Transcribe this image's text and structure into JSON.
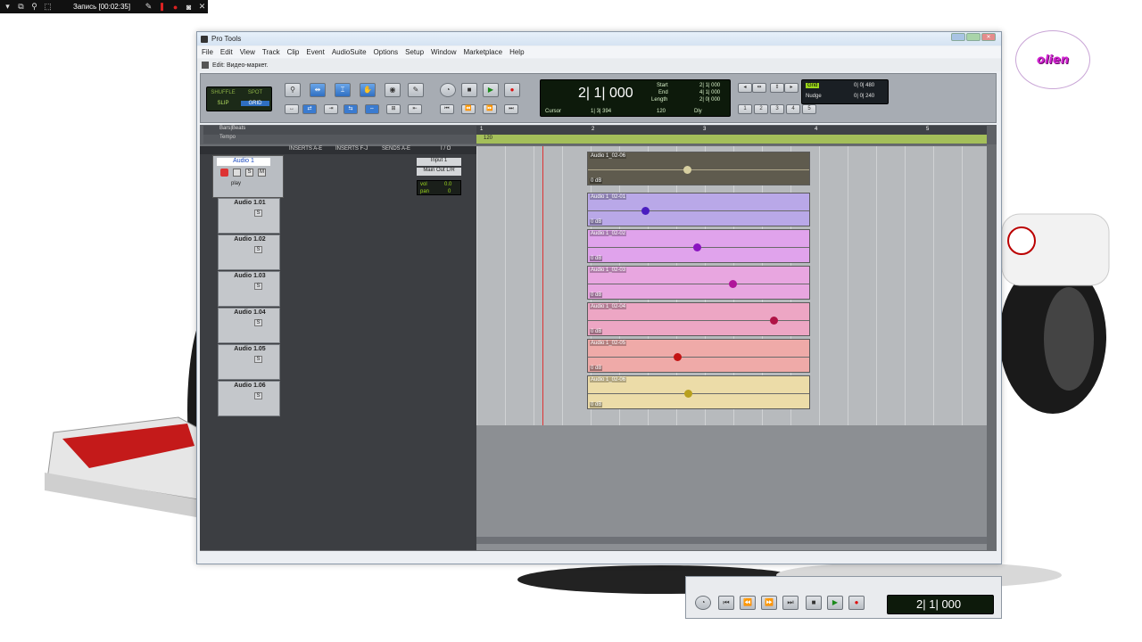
{
  "recorder": {
    "title": "Запись [00:02:35]"
  },
  "logo": {
    "text": "olien"
  },
  "window": {
    "title": "Pro Tools",
    "menu": [
      "File",
      "Edit",
      "View",
      "Track",
      "Clip",
      "Event",
      "AudioSuite",
      "Options",
      "Setup",
      "Window",
      "Marketplace",
      "Help"
    ],
    "edit_title": "Edit: Видео-маркет."
  },
  "toolbar": {
    "modes": [
      "SHUFFLE",
      "SPOT",
      "SLIP",
      "GRID"
    ],
    "counter_main": "2| 1| 000",
    "start_label": "Start",
    "end_label": "End",
    "length_label": "Length",
    "start_val": "2| 1| 000",
    "end_val": "4| 1| 000",
    "length_val": "2| 0| 000",
    "cursor_label": "Cursor",
    "cursor_val": "1| 3| 394",
    "tempo_val": "120",
    "dly_label": "Dly",
    "grid_label": "Grid",
    "grid_val": "0| 0| 480",
    "nudge_label": "Nudge",
    "nudge_val": "0| 0| 240",
    "zoom_presets": [
      "1",
      "2",
      "3",
      "4",
      "5"
    ]
  },
  "rulers": {
    "bars_label": "Bars|Beats",
    "tempo_label": "Tempo",
    "bar_markers": [
      "1",
      "2",
      "3",
      "4",
      "5"
    ],
    "tempo_marker": "120"
  },
  "columns": [
    "INSERTS A-E",
    "INSERTS F-J",
    "SENDS A-E",
    "I / O"
  ],
  "master_track": {
    "name": "Audio 1",
    "io_input": "Input 1",
    "io_output": "Main Out L/R",
    "vol_label": "vol",
    "vol_val": "0.0",
    "pan_label": "pan",
    "pan_val": "0",
    "auto_mode": "play",
    "clip_name": "Audio 1_02-06",
    "clip_db": "0 dB"
  },
  "tracks": [
    {
      "name": "Audio 1.01",
      "clip": "Audio 1_02-01",
      "db": "0 dB",
      "color": "#b9a8e8",
      "blob": "#4a1ec0",
      "pos": "0.25"
    },
    {
      "name": "Audio 1.02",
      "clip": "Audio 1_02-02",
      "db": "0 dB",
      "color": "#e0a3ec",
      "blob": "#8a14c0",
      "pos": "0.49"
    },
    {
      "name": "Audio 1.03",
      "clip": "Audio 1_02-03",
      "db": "0 dB",
      "color": "#e8a6e0",
      "blob": "#b0149a",
      "pos": "0.66"
    },
    {
      "name": "Audio 1.04",
      "clip": "Audio 1_02-04",
      "db": "0 dB",
      "color": "#eda6c4",
      "blob": "#b01446",
      "pos": "0.85"
    },
    {
      "name": "Audio 1.05",
      "clip": "Audio 1_02-05",
      "db": "0 dB",
      "color": "#efaaa8",
      "blob": "#c41414",
      "pos": "0.40"
    },
    {
      "name": "Audio 1.06",
      "clip": "Audio 1_02-06",
      "db": "0 dB",
      "color": "#ecdca8",
      "blob": "#b8a01e",
      "pos": "0.45"
    }
  ],
  "transport": {
    "counter": "2| 1| 000"
  }
}
